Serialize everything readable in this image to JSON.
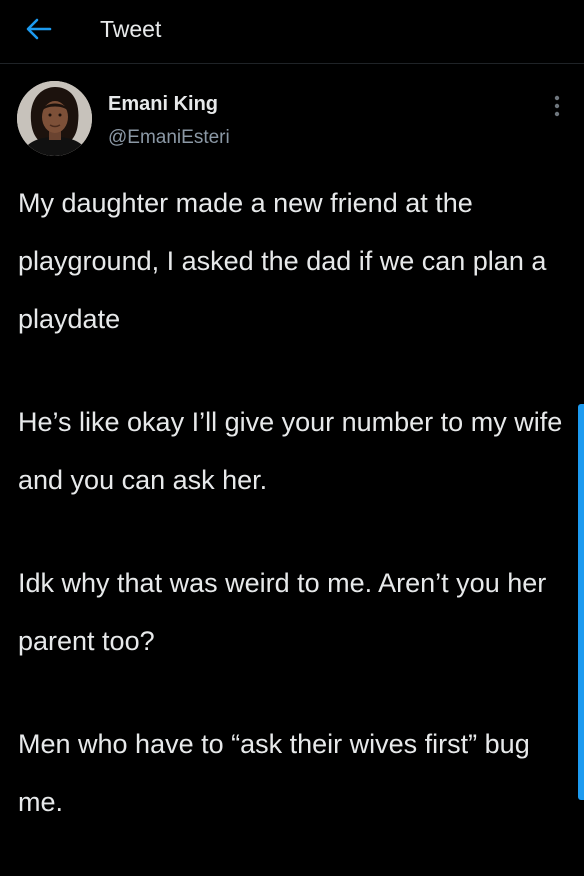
{
  "header": {
    "back_icon": "arrow-left-icon",
    "title": "Tweet",
    "accent_color": "#1d9bf0"
  },
  "tweet": {
    "author": {
      "name": "Emani King",
      "handle": "@EmaniEsteri",
      "avatar_icon": "profile-photo"
    },
    "more_icon": "more-vertical-icon",
    "paragraphs": [
      "My daughter made a new friend at the playground, I asked the dad if we can plan a playdate",
      "He’s like okay I’ll give your number to my wife and you can ask her.",
      "Idk why that was weird to me. Aren’t you her parent too?",
      "Men who have to “ask their wives first” bug me."
    ]
  },
  "colors": {
    "background": "#000000",
    "text_primary": "#e7e9ea",
    "text_secondary": "#8b98a5",
    "accent": "#1d9bf0"
  }
}
